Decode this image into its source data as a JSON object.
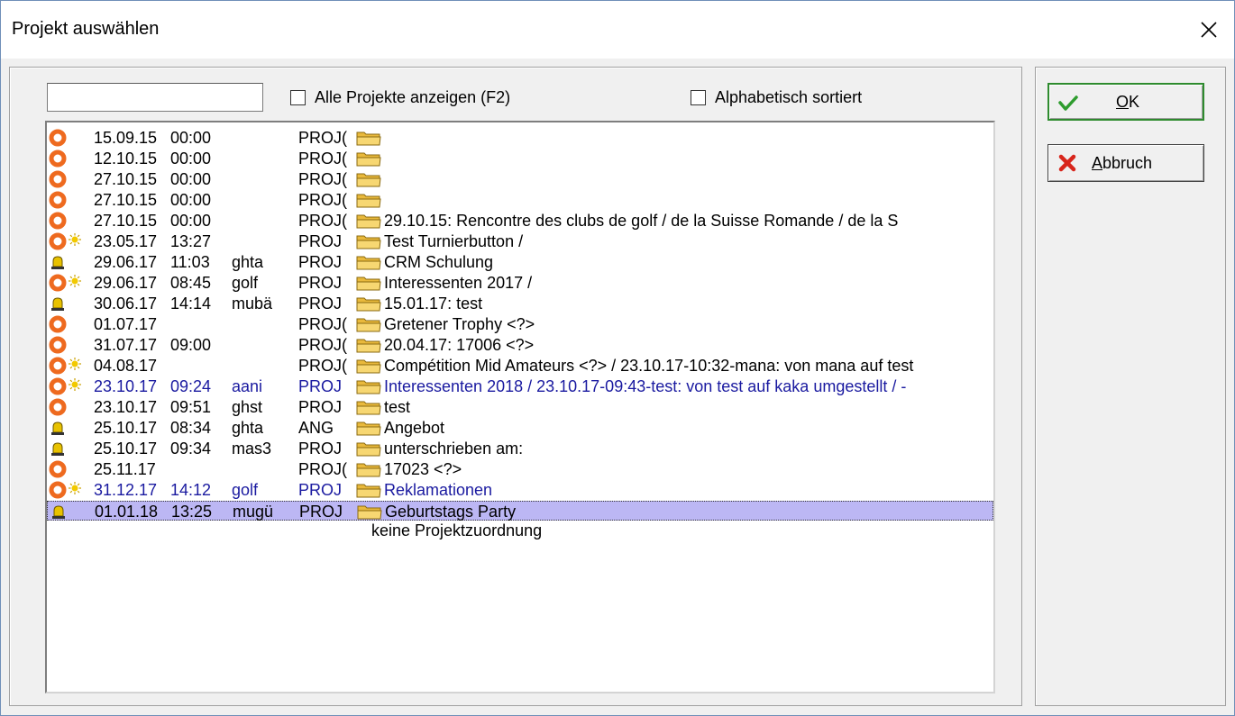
{
  "window": {
    "title": "Projekt auswählen"
  },
  "search": {
    "value": "",
    "placeholder": ""
  },
  "options": {
    "show_all_label": "Alle Projekte anzeigen (F2)",
    "alphabetical_label": "Alphabetisch sortiert"
  },
  "buttons": {
    "ok_label": "OK",
    "cancel_label": "Abbruch"
  },
  "colors": {
    "accent_selected": "#bcb7f4",
    "link_blue": "#1a1aa0",
    "ring_orange": "#ee6a1f",
    "bell_yellow": "#e8c200"
  },
  "rows": [
    {
      "icon": "orange-ring-icon",
      "new": false,
      "date": "15.09.15",
      "time": "00:00",
      "user": "",
      "type": "PROJ(",
      "title": "",
      "blue": false,
      "selected": false
    },
    {
      "icon": "orange-ring-icon",
      "new": false,
      "date": "12.10.15",
      "time": "00:00",
      "user": "",
      "type": "PROJ(",
      "title": "",
      "blue": false,
      "selected": false
    },
    {
      "icon": "orange-ring-icon",
      "new": false,
      "date": "27.10.15",
      "time": "00:00",
      "user": "",
      "type": "PROJ(",
      "title": "",
      "blue": false,
      "selected": false
    },
    {
      "icon": "orange-ring-icon",
      "new": false,
      "date": "27.10.15",
      "time": "00:00",
      "user": "",
      "type": "PROJ(",
      "title": "",
      "blue": false,
      "selected": false
    },
    {
      "icon": "orange-ring-icon",
      "new": false,
      "date": "27.10.15",
      "time": "00:00",
      "user": "",
      "type": "PROJ(",
      "title": "29.10.15: Rencontre des clubs de golf  / de la Suisse Romande / de la S",
      "blue": false,
      "selected": false
    },
    {
      "icon": "orange-ring-icon",
      "new": true,
      "date": "23.05.17",
      "time": "13:27",
      "user": "",
      "type": "PROJ",
      "title": "Test Turnierbutton /",
      "blue": false,
      "selected": false
    },
    {
      "icon": "bell-icon",
      "new": false,
      "date": "29.06.17",
      "time": "11:03",
      "user": "ghta",
      "type": "PROJ",
      "title": "CRM Schulung",
      "blue": false,
      "selected": false
    },
    {
      "icon": "orange-ring-icon",
      "new": true,
      "date": "29.06.17",
      "time": "08:45",
      "user": "golf",
      "type": "PROJ",
      "title": "Interessenten 2017 /",
      "blue": false,
      "selected": false
    },
    {
      "icon": "bell-icon",
      "new": false,
      "date": "30.06.17",
      "time": "14:14",
      "user": "mubä",
      "type": "PROJ",
      "title": "15.01.17: test",
      "blue": false,
      "selected": false
    },
    {
      "icon": "orange-ring-icon",
      "new": false,
      "date": "01.07.17",
      "time": "",
      "user": "",
      "type": "PROJ(",
      "title": "Gretener Trophy <?>",
      "blue": false,
      "selected": false
    },
    {
      "icon": "orange-ring-icon",
      "new": false,
      "date": "31.07.17",
      "time": "09:00",
      "user": "",
      "type": "PROJ(",
      "title": "20.04.17: 17006 <?>",
      "blue": false,
      "selected": false
    },
    {
      "icon": "orange-ring-icon",
      "new": true,
      "date": "04.08.17",
      "time": "",
      "user": "",
      "type": "PROJ(",
      "title": "Compétition Mid Amateurs <?> / 23.10.17-10:32-mana: von mana auf test",
      "blue": false,
      "selected": false
    },
    {
      "icon": "orange-ring-icon",
      "new": true,
      "date": "23.10.17",
      "time": "09:24",
      "user": "aani",
      "type": "PROJ",
      "title": "Interessenten 2018 / 23.10.17-09:43-test: von test auf kaka umgestellt / -",
      "blue": true,
      "selected": false
    },
    {
      "icon": "orange-ring-icon",
      "new": false,
      "date": "23.10.17",
      "time": "09:51",
      "user": "ghst",
      "type": "PROJ",
      "title": "test",
      "blue": false,
      "selected": false
    },
    {
      "icon": "bell-icon",
      "new": false,
      "date": "25.10.17",
      "time": "08:34",
      "user": "ghta",
      "type": "ANG",
      "title": "Angebot",
      "blue": false,
      "selected": false
    },
    {
      "icon": "bell-icon",
      "new": false,
      "date": "25.10.17",
      "time": "09:34",
      "user": "mas3",
      "type": "PROJ",
      "title": "unterschrieben am:",
      "blue": false,
      "selected": false
    },
    {
      "icon": "orange-ring-icon",
      "new": false,
      "date": "25.11.17",
      "time": "",
      "user": "",
      "type": "PROJ(",
      "title": "17023 <?>",
      "blue": false,
      "selected": false
    },
    {
      "icon": "orange-ring-icon",
      "new": true,
      "date": "31.12.17",
      "time": "14:12",
      "user": "golf",
      "type": "PROJ",
      "title": "Reklamationen",
      "blue": true,
      "selected": false
    },
    {
      "icon": "bell-icon",
      "new": false,
      "date": "01.01.18",
      "time": "13:25",
      "user": "mugü",
      "type": "PROJ",
      "title": "Geburtstags Party",
      "blue": false,
      "selected": true
    }
  ],
  "no_project_label": "keine Projektzuordnung"
}
